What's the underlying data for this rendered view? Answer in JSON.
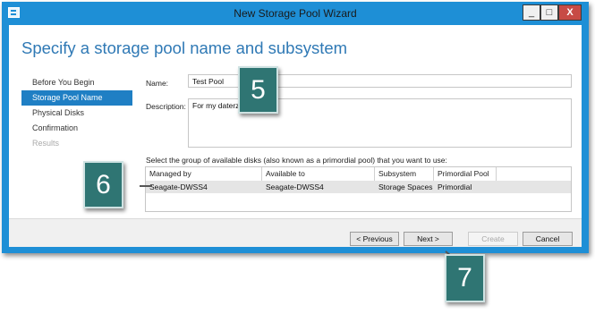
{
  "window": {
    "title": "New Storage Pool Wizard"
  },
  "titlebar_buttons": {
    "minimize": "_",
    "maximize": "□",
    "close": "X"
  },
  "page": {
    "heading": "Specify a storage pool name and subsystem"
  },
  "nav": {
    "items": [
      {
        "label": "Before You Begin",
        "state": "normal"
      },
      {
        "label": "Storage Pool Name",
        "state": "active"
      },
      {
        "label": "Physical Disks",
        "state": "normal"
      },
      {
        "label": "Confirmation",
        "state": "normal"
      },
      {
        "label": "Results",
        "state": "disabled"
      }
    ]
  },
  "form": {
    "name_label": "Name:",
    "name_value": "Test Pool",
    "description_label": "Description:",
    "description_value": "For my daterz.",
    "disk_group_prompt": "Select the group of available disks (also known as a primordial pool) that you want to use:"
  },
  "grid": {
    "columns": [
      "Managed by",
      "Available to",
      "Subsystem",
      "Primordial Pool"
    ],
    "rows": [
      [
        "Seagate-DWSS4",
        "Seagate-DWSS4",
        "Storage Spaces",
        "Primordial"
      ]
    ]
  },
  "buttons": {
    "previous": "< Previous",
    "next": "Next >",
    "create": "Create",
    "cancel": "Cancel"
  },
  "callouts": {
    "five": "5",
    "six": "6",
    "seven": "7"
  },
  "colors": {
    "titlebar": "#1e8fd6",
    "heading": "#2f79b5",
    "nav_active": "#1f7fc4",
    "callout": "#2f7573",
    "selected_row": "#e5e5e5"
  }
}
